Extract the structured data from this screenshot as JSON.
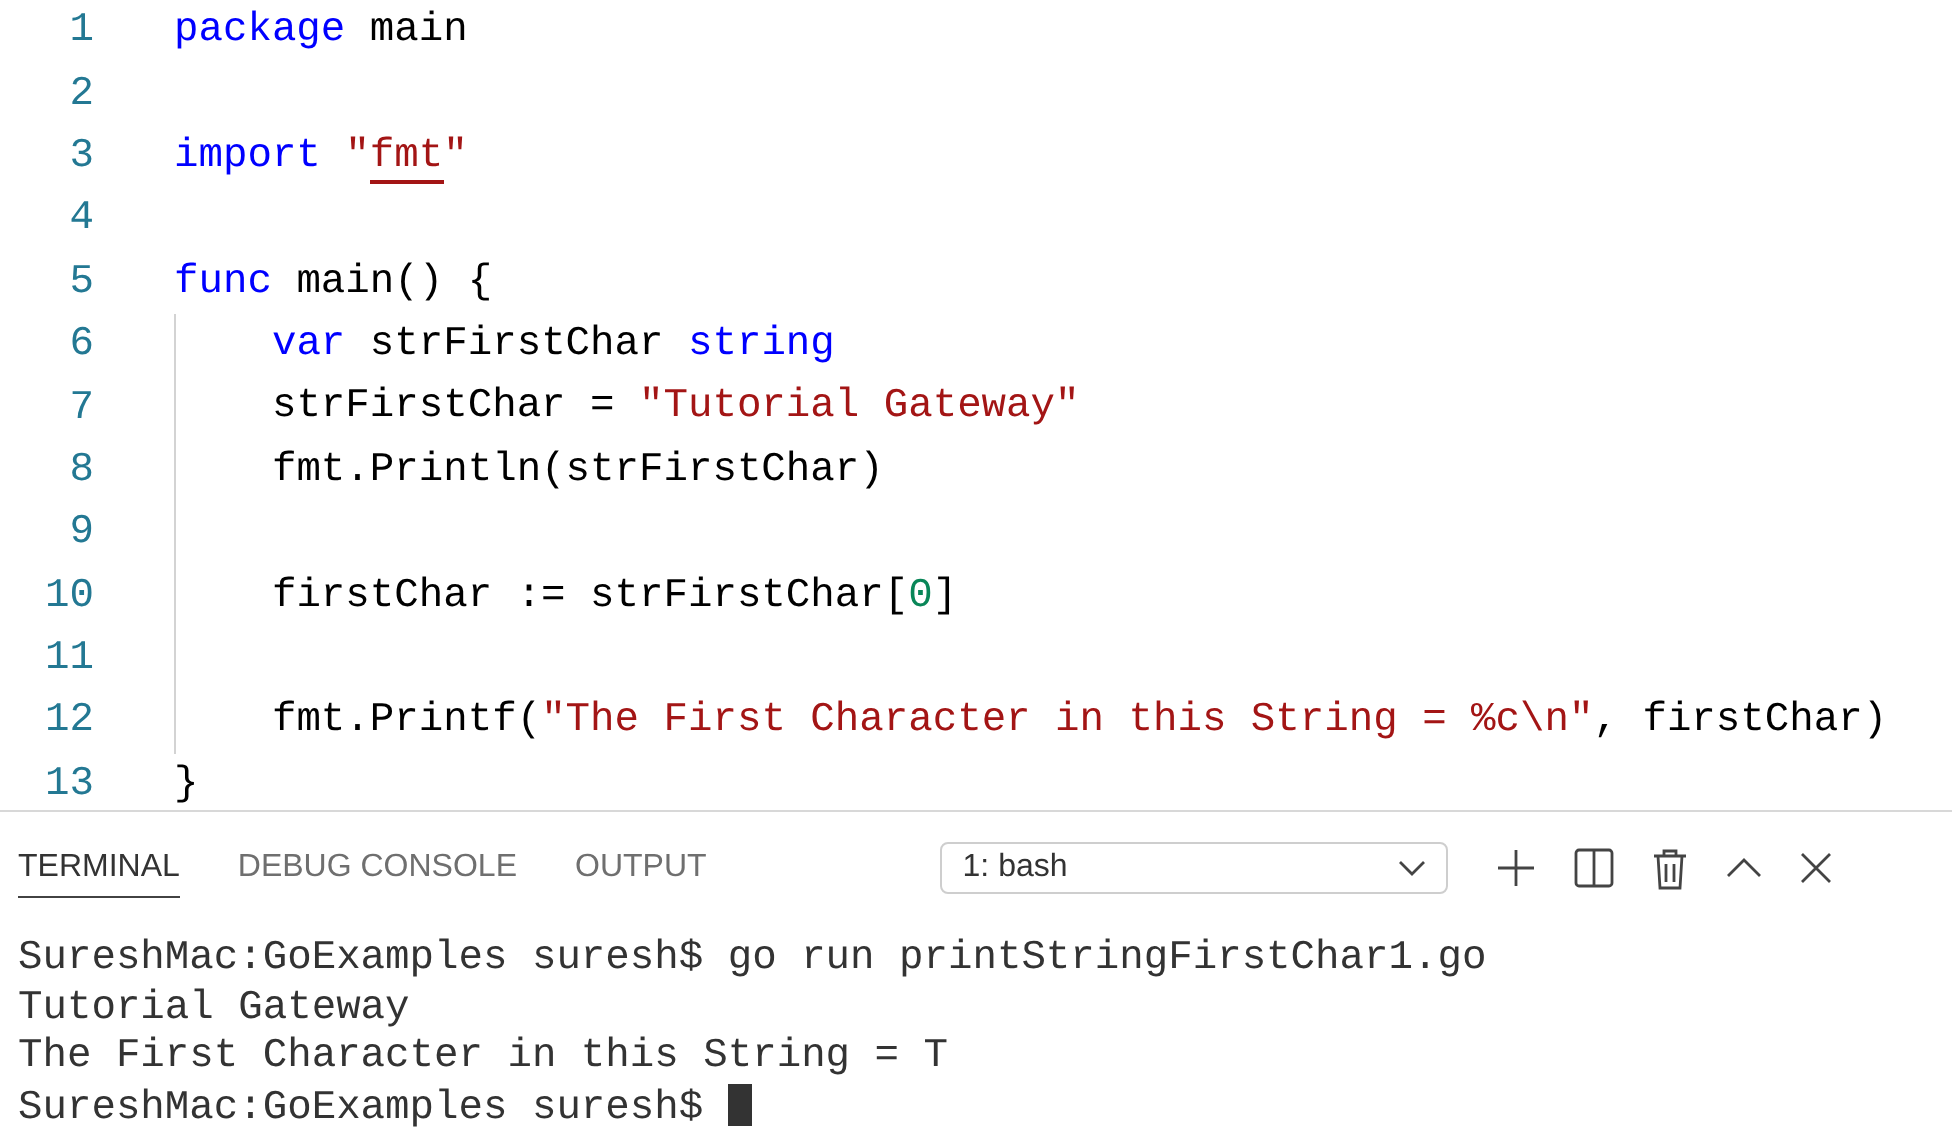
{
  "editor": {
    "lines": [
      {
        "number": "1",
        "tokens": [
          {
            "kind": "keyword",
            "text": "package"
          },
          {
            "kind": "plain",
            "text": " main"
          }
        ]
      },
      {
        "number": "2"
      },
      {
        "number": "3",
        "tokens": [
          {
            "kind": "keyword",
            "text": "import"
          },
          {
            "kind": "string",
            "text": " \""
          },
          {
            "kind": "string",
            "text": "fmt",
            "underlined": true
          },
          {
            "kind": "string",
            "text": "\""
          }
        ]
      },
      {
        "number": "4"
      },
      {
        "number": "5",
        "tokens": [
          {
            "kind": "keyword",
            "text": "func"
          },
          {
            "kind": "plain",
            "text": " main() {"
          }
        ],
        "children": [
          {
            "number": "6",
            "tokens": [
              {
                "kind": "keyword",
                "text": "var"
              },
              {
                "kind": "plain",
                "text": " strFirstChar "
              },
              {
                "kind": "keyword",
                "text": "string"
              }
            ]
          },
          {
            "number": "7",
            "tokens": [
              {
                "kind": "plain",
                "text": "strFirstChar = "
              },
              {
                "kind": "string",
                "text": "\"Tutorial Gateway\""
              }
            ]
          },
          {
            "number": "8",
            "tokens": [
              {
                "kind": "plain",
                "text": "fmt.Println(strFirstChar)"
              }
            ]
          },
          {
            "number": "9"
          },
          {
            "number": "10",
            "tokens": [
              {
                "kind": "plain",
                "text": "firstChar := strFirstChar["
              },
              {
                "kind": "number",
                "text": "0"
              },
              {
                "kind": "plain",
                "text": "]"
              }
            ]
          },
          {
            "number": "11"
          },
          {
            "number": "12",
            "tokens": [
              {
                "kind": "plain",
                "text": "fmt.Printf("
              },
              {
                "kind": "string",
                "text": "\"The First Character in this String = %c\\n\""
              },
              {
                "kind": "plain",
                "text": ", firstChar)"
              }
            ]
          }
        ]
      },
      {
        "number": "13",
        "tokens": [
          {
            "kind": "plain",
            "text": "}"
          }
        ]
      }
    ]
  },
  "panel": {
    "tabs": [
      {
        "label": "TERMINAL",
        "selected": true
      },
      {
        "label": "DEBUG CONSOLE",
        "selected": false
      },
      {
        "label": "OUTPUT",
        "selected": false
      }
    ],
    "terminal_select": {
      "value": "1: bash"
    },
    "output": [
      {
        "text": "SureshMac:GoExamples suresh$ go run printStringFirstChar1.go",
        "cursor": false
      },
      {
        "text": "Tutorial Gateway",
        "cursor": false
      },
      {
        "text": "The First Character in this String = T",
        "cursor": false
      },
      {
        "text": "SureshMac:GoExamples suresh$ ",
        "cursor": true
      }
    ]
  }
}
